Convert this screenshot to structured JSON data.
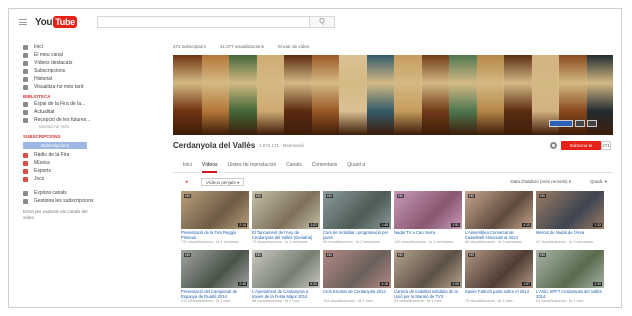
{
  "masthead": {
    "logo_you": "You",
    "logo_tube": "Tube",
    "search_button": "Q"
  },
  "guide": {
    "top": [
      {
        "label": "Inici",
        "icon": "home-icon"
      },
      {
        "label": "El meu canal",
        "icon": "user-icon"
      },
      {
        "label": "Vídeos destacats",
        "icon": "fire-icon"
      },
      {
        "label": "Subscripcions",
        "icon": "subscriptions-icon"
      },
      {
        "label": "Historial",
        "icon": "history-icon"
      },
      {
        "label": "Visualitza-ho més tard",
        "icon": "clock-icon"
      }
    ],
    "section1_title": "BIBLIOTECA",
    "library": [
      {
        "label": "Espai de la Fira de la...",
        "icon": "list-icon"
      },
      {
        "label": "Actualitat",
        "icon": "list-icon"
      },
      {
        "label": "Recepció de les futures...",
        "icon": "list-icon"
      }
    ],
    "library_more": "Mostra-ne més",
    "section2_title": "SUBSCRIPCIONS",
    "chip": "Subscripcions",
    "subs": [
      {
        "label": "Ràdio de la Fira",
        "icon": "channel-icon"
      },
      {
        "label": "Música",
        "icon": "channel-icon"
      },
      {
        "label": "Esports",
        "icon": "channel-icon"
      },
      {
        "label": "Jocs",
        "icon": "channel-icon"
      }
    ],
    "bottom": [
      {
        "label": "Explora canals",
        "icon": "plus-icon"
      },
      {
        "label": "Gestiona les subscripcions",
        "icon": "gear-icon"
      }
    ],
    "note": "Entra per explorar els canals del vídeo"
  },
  "channel": {
    "links": [
      "271 subscriptors",
      "41.077 visualitzacions",
      "Enviar de vídeo"
    ],
    "title": "Cerdanyola del Vallès",
    "views": "1.072.171 · Reemissió",
    "subscribe": "Subscriu-te",
    "sub_count": "271",
    "tabs": [
      "Inici",
      "Vídeos",
      "Llistes de reproducció",
      "Canals",
      "Comentaris",
      "Quant a"
    ],
    "active_tab": 1,
    "filter_toggle": "◂",
    "filter_select": "Vídeos penjats ▾",
    "sort": "Data d'addició (més recents) ▾",
    "grid_option": "Quadr. ▾"
  },
  "banner_colors": [
    "#6f3312",
    "#b77a3a",
    "#3f6a3a",
    "#d4b078",
    "#5a2a10",
    "#9b5a26",
    "#e0c79a",
    "#2f5c6e",
    "#c9a060",
    "#703a18",
    "#4c7a52",
    "#b88a4a",
    "#5b2d12",
    "#d8b888",
    "#8a4a1e",
    "#1d2b33"
  ],
  "videos": [
    {
      "title": "Presentació de la Fira Reggio Pirineus",
      "meta": "731 visualitzacions · fa 1 setmana",
      "duration": "2:14",
      "c1": "#b9a07d",
      "c2": "#6e5b44"
    },
    {
      "title": "El Tancament de l'Any de Cerdanyola del Vallès (Geriatria) Básica",
      "meta": "72 visualitzacions · fa 1 setmana",
      "duration": "3:02",
      "c1": "#c7c0a8",
      "c2": "#7d705a"
    },
    {
      "title": "Curs de mobilitat i programació per joves",
      "meta": "59 visualitzacions · fa 2 setmanes",
      "duration": "1:48",
      "c1": "#8a9a9c",
      "c2": "#4d5a55"
    },
    {
      "title": "Nadal TV a Can Serra",
      "meta": "120 visualitzacions · fa 2 setmanes",
      "duration": "2:51",
      "c1": "#c79ab8",
      "c2": "#8a5670"
    },
    {
      "title": "L'Assemblea Comarcal de Castellvell Associats al 2014",
      "meta": "66 visualitzacions · fa 3 setmanes",
      "duration": "4:10",
      "c1": "#c6a78f",
      "c2": "#5e4a3d"
    },
    {
      "title": "Mercat de Nadal de l'Àrea",
      "meta": "47 visualitzacions · fa 3 setmanes",
      "duration": "1:33",
      "c1": "#9b7c63",
      "c2": "#3e4552"
    },
    {
      "title": "Presentació del Campionat de Espanya de Duatló 2014",
      "meta": "211 visualitzacions · fa 1 mes",
      "duration": "2:45",
      "c1": "#9fa6a0",
      "c2": "#4a5348"
    },
    {
      "title": "L'Ajuntament de Cerdanyola a través de la Festa Major 2014",
      "meta": "88 visualitzacions · fa 1 mes",
      "duration": "5:20",
      "c1": "#c9c9c2",
      "c2": "#767f72"
    },
    {
      "title": "Cros Escolar de Cerdanyola 2014",
      "meta": "104 visualitzacions · fa 1 mes",
      "duration": "3:18",
      "c1": "#b38b86",
      "c2": "#6b5f5a"
    },
    {
      "title": "Carrera de mobilitat solidària de la Unió per la Marató de TV3",
      "meta": "93 visualitzacions · fa 1 mes",
      "duration": "2:06",
      "c1": "#b5a591",
      "c2": "#5d5145"
    },
    {
      "title": "Xavier Fabrich parla sobre el 2014",
      "meta": "76 visualitzacions · fa 1 mes",
      "duration": "1:57",
      "c1": "#b49a88",
      "c2": "#4f3c33"
    },
    {
      "title": "L'Antic SPFT Cerdanyola del Vallès 2014",
      "meta": "61 visualitzacions · fa 1 mes",
      "duration": "2:39",
      "c1": "#a8b4a6",
      "c2": "#5a6b4f"
    }
  ]
}
